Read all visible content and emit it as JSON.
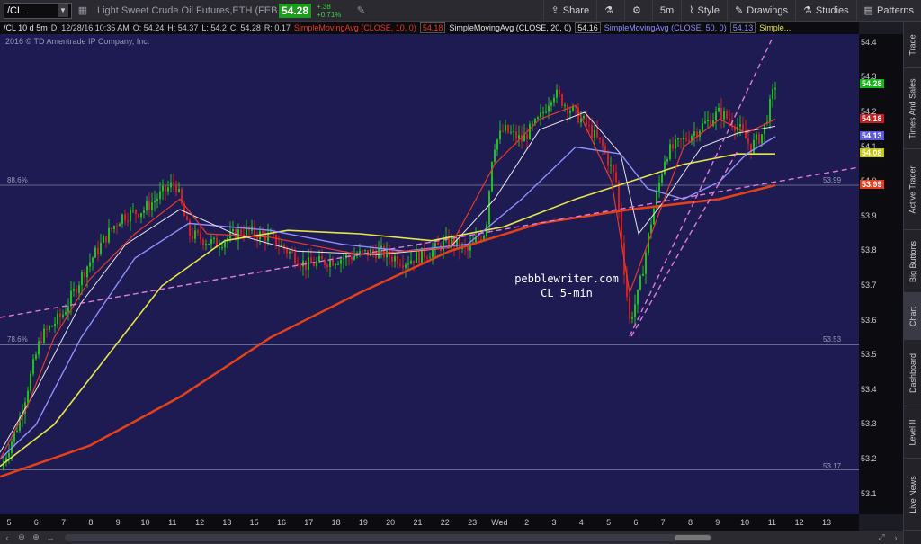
{
  "toolbar": {
    "symbol": "/CL",
    "instrument": "Light Sweet Crude Oil Futures,ETH (FEB 17)",
    "last_price": "54.28",
    "change": "+.38",
    "change_pct": "+0.71%",
    "share_label": "Share",
    "interval_label": "5m",
    "style_label": "Style",
    "drawings_label": "Drawings",
    "studies_label": "Studies",
    "patterns_label": "Patterns"
  },
  "studies_bar": {
    "symbol": "/CL 10 d 5m",
    "date": "D: 12/28/16 10:35 AM",
    "open": "O: 54.24",
    "high": "H: 54.37",
    "low": "L: 54.2",
    "close": "C: 54.28",
    "range": "R: 0.17",
    "sma10_label": "SimpleMovingAvg (CLOSE, 10, 0)",
    "sma10_value": "54.18",
    "sma20_label": "SimpleMovingAvg (CLOSE, 20, 0)",
    "sma20_value": "54.16",
    "sma50_label": "SimpleMovingAvg (CLOSE, 50, 0)",
    "sma50_value": "54.13",
    "more": "Simple..."
  },
  "chart": {
    "copyright": "2016 © TD Ameritrade IP Company, Inc.",
    "watermark_line1": "pebblewriter.com",
    "watermark_line2": "CL 5-min",
    "fib_886_label": "88.6%",
    "fib_886_value": "53.99",
    "fib_786_label": "78.6%",
    "fib_786_value": "53.53",
    "fib_base_value": "53.17"
  },
  "price_axis": {
    "ticks": [
      "54.4",
      "54.3",
      "54.2",
      "54.1",
      "54.0",
      "53.9",
      "53.8",
      "53.7",
      "53.6",
      "53.5",
      "53.4",
      "53.3",
      "53.2",
      "53.1"
    ],
    "badges": [
      {
        "value": "54.28",
        "color": "#12b812"
      },
      {
        "value": "54.18",
        "color": "#c81e1e"
      },
      {
        "value": "54.13",
        "color": "#5a5ae0"
      },
      {
        "value": "54.08",
        "color": "#c8c800"
      },
      {
        "value": "53.99",
        "color": "#e43c1a"
      }
    ]
  },
  "time_axis": {
    "labels": [
      "5",
      "6",
      "7",
      "8",
      "9",
      "10",
      "11",
      "12",
      "13",
      "15",
      "16",
      "17",
      "18",
      "19",
      "20",
      "21",
      "22",
      "23",
      "Wed",
      "2",
      "3",
      "4",
      "5",
      "6",
      "7",
      "8",
      "9",
      "10",
      "11",
      "12",
      "13"
    ]
  },
  "side_tabs": [
    "Trade",
    "Times And Sales",
    "Active Trader",
    "Big Buttons",
    "Chart",
    "Dashboard",
    "Level II",
    "Live News"
  ],
  "colors": {
    "background": "#1e1a52",
    "sma10": "#e23b2b",
    "sma20": "#e6e6e6",
    "sma50": "#8f8fff",
    "sma_yellow": "#e6e64a",
    "sma_orange": "#e4411a",
    "trendline": "#e07bd8",
    "candle_up": "#1fbf1f",
    "candle_down": "#d02020"
  }
}
